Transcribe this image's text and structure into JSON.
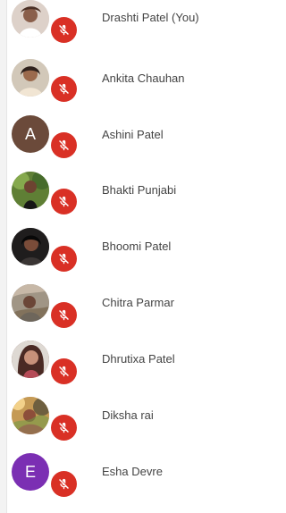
{
  "participants": [
    {
      "name": "Drashti Patel (You)",
      "initial": "",
      "avatar_color": "#d9cfc8",
      "mic_status": "muted"
    },
    {
      "name": "Ankita Chauhan",
      "initial": "",
      "avatar_color": "#c8b9a5",
      "mic_status": "muted"
    },
    {
      "name": "Ashini Patel",
      "initial": "A",
      "avatar_color": "#6b4a3a",
      "mic_status": "muted"
    },
    {
      "name": "Bhakti Punjabi",
      "initial": "",
      "avatar_color": "#6f8f3f",
      "mic_status": "muted"
    },
    {
      "name": "Bhoomi Patel",
      "initial": "",
      "avatar_color": "#2e2a28",
      "mic_status": "muted"
    },
    {
      "name": "Chitra Parmar",
      "initial": "",
      "avatar_color": "#8f7f6e",
      "mic_status": "muted"
    },
    {
      "name": "Dhrutixa Patel",
      "initial": "",
      "avatar_color": "#7b4c43",
      "mic_status": "muted"
    },
    {
      "name": "Diksha rai",
      "initial": "",
      "avatar_color": "#b88a49",
      "mic_status": "muted"
    },
    {
      "name": "Esha Devre",
      "initial": "E",
      "avatar_color": "#7b2fb3",
      "mic_status": "muted"
    }
  ],
  "colors": {
    "mic_badge": "#d93025",
    "name_text": "#444444"
  },
  "icons": {
    "mic_status": "microphone-off-icon"
  }
}
